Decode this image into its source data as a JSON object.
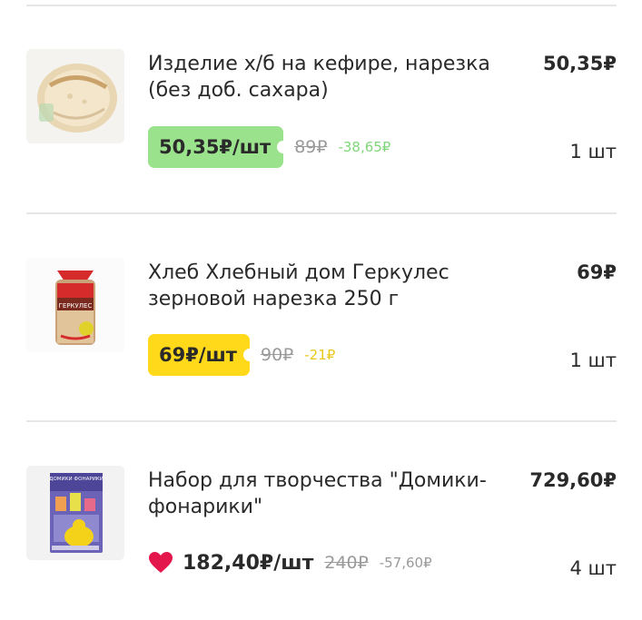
{
  "cart": {
    "items": [
      {
        "title": "Изделие х/б на кефире, нарезка (без доб. сахара)",
        "total": "50,35₽",
        "unit_price": "50,35₽/шт",
        "old_price": "89₽",
        "discount": "-38,65₽",
        "quantity": "1 шт",
        "badge_color": "#9ae28c",
        "image_icon": "bread-loaf-image"
      },
      {
        "title": "Хлеб Хлебный дом Геркулес зерновой нарезка 250 г",
        "total": "69₽",
        "unit_price": "69₽/шт",
        "old_price": "90₽",
        "discount": "-21₽",
        "quantity": "1 шт",
        "badge_color": "#ffd91a",
        "image_icon": "bread-package-image",
        "package_label": "ГЕРКУЛЕС"
      },
      {
        "title": "Набор для творчества \"Домики-фонарики\"",
        "total": "729,60₽",
        "unit_price": "182,40₽/шт",
        "old_price": "240₽",
        "discount": "-57,60₽",
        "quantity": "4 шт",
        "heart_color": "#e3174c",
        "image_icon": "craft-kit-box-image",
        "box_label": "ДОМИКИ ФОНАРИКИ"
      }
    ]
  }
}
